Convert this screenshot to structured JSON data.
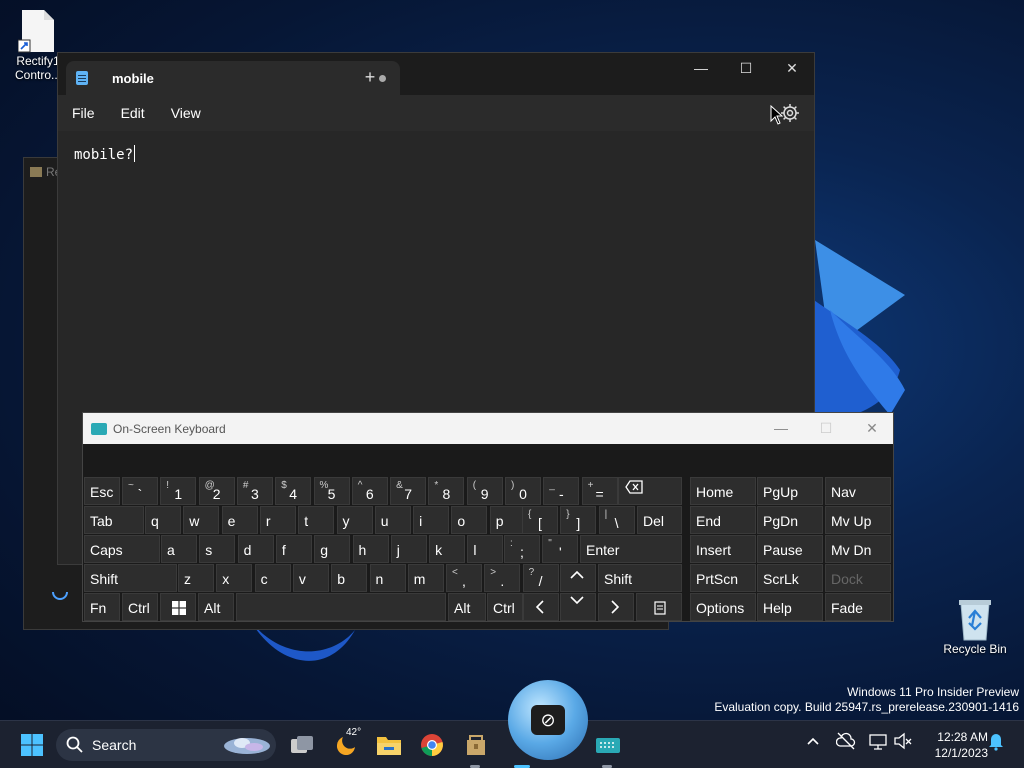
{
  "desktop": {
    "icon1_label_line1": "Rectify1",
    "icon1_label_line2": "Contro...",
    "recycle_label": "Recycle Bin",
    "bg_window_title": "Re"
  },
  "notepad": {
    "tab_title": "mobile",
    "new_tab": "+",
    "minimize": "—",
    "maximize": "☐",
    "close": "✕",
    "menu": [
      "File",
      "Edit",
      "View"
    ],
    "content": "mobile?"
  },
  "osk": {
    "title": "On-Screen Keyboard",
    "minimize": "—",
    "maximize": "☐",
    "close": "✕",
    "keys": {
      "esc": "Esc",
      "tab": "Tab",
      "caps": "Caps",
      "shift": "Shift",
      "fn": "Fn",
      "ctrl": "Ctrl",
      "alt": "Alt",
      "del": "Del",
      "enter": "Enter",
      "home": "Home",
      "pgup": "PgUp",
      "nav": "Nav",
      "end": "End",
      "pgdn": "PgDn",
      "mvup": "Mv Up",
      "insert": "Insert",
      "pause": "Pause",
      "mvdn": "Mv Dn",
      "prtscn": "PrtScn",
      "scrlk": "ScrLk",
      "dock": "Dock",
      "options": "Options",
      "help": "Help",
      "fade": "Fade",
      "row1": [
        [
          "~",
          "`"
        ],
        [
          "!",
          "1"
        ],
        [
          "@",
          "2"
        ],
        [
          "#",
          "3"
        ],
        [
          "$",
          "4"
        ],
        [
          "%",
          "5"
        ],
        [
          "^",
          "6"
        ],
        [
          "&",
          "7"
        ],
        [
          "*",
          "8"
        ],
        [
          "(",
          "9"
        ],
        [
          ")",
          "0"
        ],
        [
          "_",
          "-"
        ],
        [
          "+",
          "="
        ]
      ],
      "row2": [
        "q",
        "w",
        "e",
        "r",
        "t",
        "y",
        "u",
        "i",
        "o",
        "p"
      ],
      "row2b": [
        [
          "{",
          "["
        ],
        [
          "}",
          "]"
        ],
        [
          "|",
          "\\"
        ]
      ],
      "row3": [
        "a",
        "s",
        "d",
        "f",
        "g",
        "h",
        "j",
        "k",
        "l"
      ],
      "row3b": [
        [
          ":",
          ";"
        ],
        [
          "\"",
          "'"
        ]
      ],
      "row4": [
        "z",
        "x",
        "c",
        "v",
        "b",
        "n",
        "m"
      ],
      "row4b": [
        [
          "<",
          ","
        ],
        [
          ">",
          "."
        ],
        [
          "?",
          "/"
        ]
      ]
    }
  },
  "watermark": {
    "line1": "Windows 11 Pro Insider Preview",
    "line2": "Evaluation copy. Build 25947.rs_prerelease.230901-1416"
  },
  "taskbar": {
    "search_placeholder": "Search",
    "weather_temp": "42°",
    "time": "12:28 AM",
    "date": "12/1/2023"
  }
}
